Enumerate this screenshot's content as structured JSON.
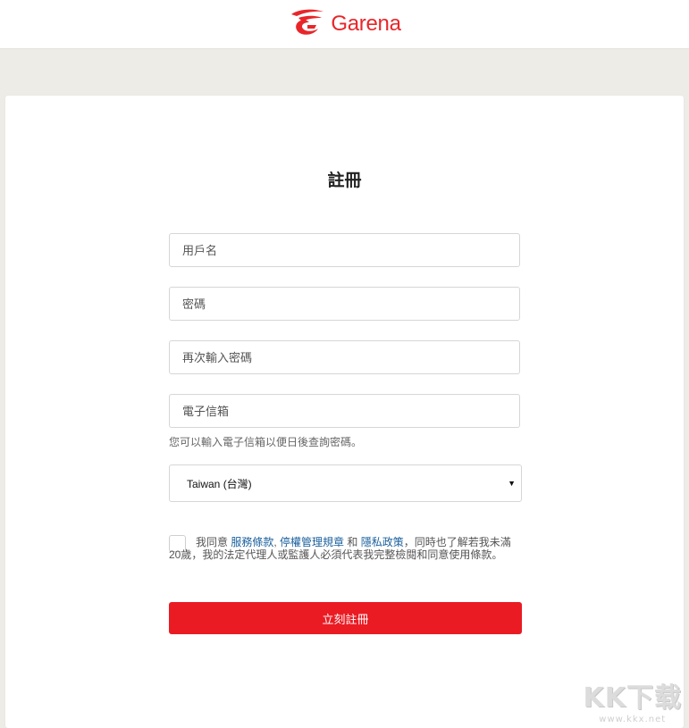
{
  "header": {
    "logo_text": "Garena",
    "brand_color": "#e8262a"
  },
  "form": {
    "title": "註冊",
    "username_placeholder": "用戶名",
    "password_placeholder": "密碼",
    "confirm_password_placeholder": "再次輸入密碼",
    "email_placeholder": "電子信箱",
    "email_hint": "您可以輸入電子信箱以便日後查詢密碼。",
    "country_selected": "Taiwan (台灣)",
    "agreement": {
      "prefix": "我同意 ",
      "terms_link": "服務條款",
      "sep1": ", ",
      "suspension_link": "停權管理規章",
      "sep2": " 和 ",
      "privacy_link": "隱私政策",
      "suffix": "，同時也了解若我未滿20歲，我的法定代理人或監護人必須代表我完整檢閱和同意使用條款。"
    },
    "submit_label": "立刻註冊",
    "submit_color": "#ea1b23",
    "link_color": "#1a5f9c"
  },
  "watermark": {
    "main": "KK下载",
    "sub": "www.kkx.net"
  }
}
